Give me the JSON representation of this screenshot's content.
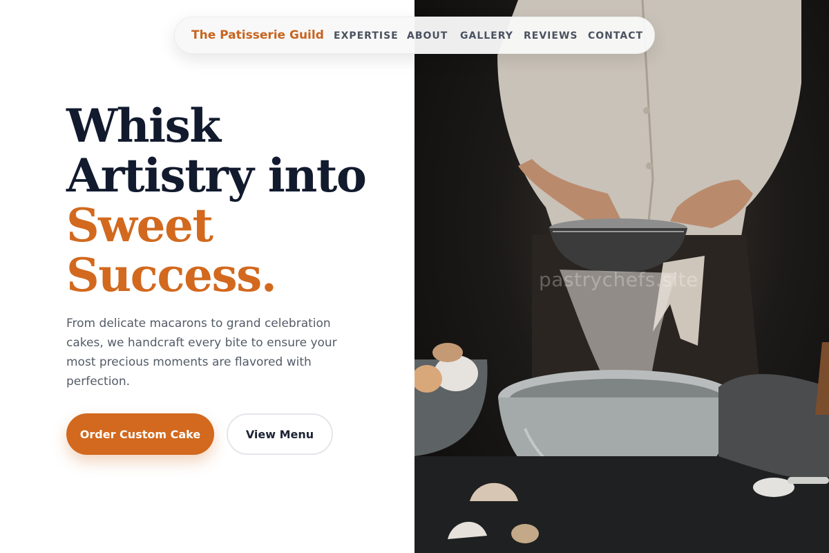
{
  "nav": {
    "brand": "The Patisserie Guild",
    "links": [
      "EXPERTISE",
      "ABOUT",
      "GALLERY",
      "REVIEWS",
      "CONTACT"
    ]
  },
  "hero": {
    "headline_lines": [
      "Whisk",
      "Artistry into"
    ],
    "headline_accent_lines": [
      "Sweet",
      "Success."
    ],
    "description": "From delicate macarons to grand celebration cakes, we handcraft every bite to ensure your most precious moments are flavored with perfection.",
    "primary_button": "Order Custom Cake",
    "secondary_button": "View Menu"
  },
  "image": {
    "subject": "baker sifting flour into a bowl",
    "watermark": "pastrychefs.site"
  },
  "colors": {
    "accent": "#d2691e",
    "heading": "#121a2e",
    "body_text": "#535b67",
    "brand": "#c8641e"
  }
}
